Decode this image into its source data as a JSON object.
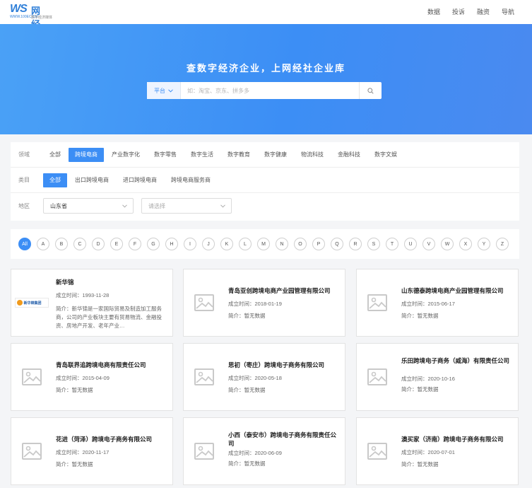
{
  "header": {
    "logo_ws": "WS",
    "logo_cn": "网经社",
    "logo_url": "WWW.100EC.CN",
    "logo_tagline": "数字经济媒体",
    "nav": [
      "数据",
      "投诉",
      "融资",
      "导航"
    ]
  },
  "hero": {
    "title": "查数字经济企业，上网经社企业库",
    "search_type": "平台",
    "search_placeholder": "如：淘宝、京东、拼多多",
    "search_icon": "search-icon"
  },
  "filters": {
    "domain_label": "领域",
    "domain_options": [
      "全部",
      "跨境电商",
      "产业数字化",
      "数字零售",
      "数字生活",
      "数字教育",
      "数字健康",
      "物流科技",
      "金融科技",
      "数字文娱"
    ],
    "domain_active": 1,
    "category_label": "类目",
    "category_options": [
      "全部",
      "出口跨境电商",
      "进口跨境电商",
      "跨境电商服务商"
    ],
    "category_active": 0,
    "region_label": "地区",
    "region_value": "山东省",
    "region2_placeholder": "请选择"
  },
  "letters": {
    "items": [
      "All",
      "A",
      "B",
      "C",
      "D",
      "E",
      "F",
      "G",
      "H",
      "I",
      "J",
      "K",
      "L",
      "M",
      "N",
      "O",
      "P",
      "Q",
      "R",
      "S",
      "T",
      "U",
      "V",
      "W",
      "X",
      "Y",
      "Z"
    ],
    "active": 0
  },
  "companies": [
    {
      "name": "新华锦",
      "founded": "成立时间：1993-11-28",
      "desc": "简介：新华锦是一家国际贸易及制造加工服务商，公司的产业板块主要有贸易物流、金融投资、房地产开发、老年产业…",
      "logo": "新华锦集团"
    },
    {
      "name": "青岛亚创跨境电商产业园管理有限公司",
      "founded": "成立时间：2018-01-19",
      "desc": "简介：暂无数据"
    },
    {
      "name": "山东德泰跨境电商产业园管理有限公司",
      "founded": "成立时间：2015-06-17",
      "desc": "简介：暂无数据"
    },
    {
      "name": "青岛联界追跨境电商有限责任公司",
      "founded": "成立时间：2015-04-09",
      "desc": "简介：暂无数据"
    },
    {
      "name": "思初（枣庄）跨境电子商务有限公司",
      "founded": "成立时间：2020-05-18",
      "desc": "简介：暂无数据"
    },
    {
      "name": "乐田跨境电子商务（威海）有限责任公司",
      "founded": "成立时间：2020-10-16",
      "desc": "简介：暂无数据"
    },
    {
      "name": "花进（菏泽）跨境电子商务有限公司",
      "founded": "成立时间：2020-11-17",
      "desc": "简介：暂无数据"
    },
    {
      "name": "小西（泰安市）跨境电子商务有限责任公司",
      "founded": "成立时间：2020-06-09",
      "desc": "简介：暂无数据"
    },
    {
      "name": "澳买家（济南）跨境电子商务有限公司",
      "founded": "成立时间：2020-07-01",
      "desc": "简介：暂无数据"
    }
  ],
  "colors": {
    "accent": "#3c8ef5",
    "hero_start": "#4aa1f6",
    "hero_end": "#4a8af0"
  }
}
